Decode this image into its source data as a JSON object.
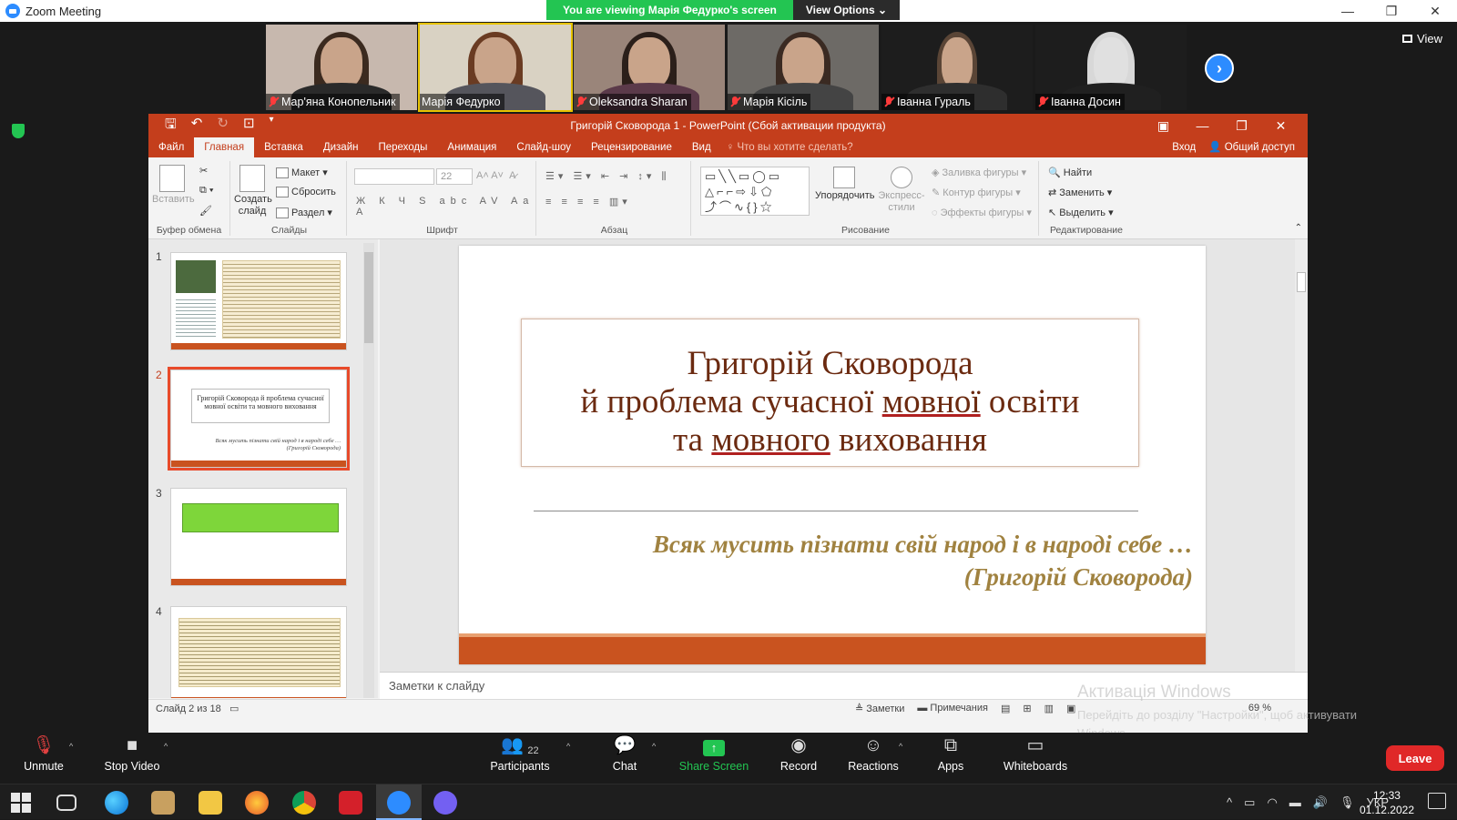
{
  "zoom": {
    "window_title": "Zoom Meeting",
    "share_banner": "You are viewing Марія Федурко's screen",
    "view_options": "View Options",
    "view_label": "View",
    "participants": [
      {
        "name": "Мар'яна Конопельник",
        "muted": true
      },
      {
        "name": "Марія Федурко",
        "muted": false
      },
      {
        "name": "Oleksandra Sharan",
        "muted": true
      },
      {
        "name": "Марія Кісіль",
        "muted": true
      },
      {
        "name": "Іванна Гураль",
        "muted": true
      },
      {
        "name": "Іванна Досин",
        "muted": true
      }
    ],
    "toolbar": {
      "unmute": "Unmute",
      "stop_video": "Stop Video",
      "participants": "Participants",
      "participants_count": "22",
      "chat": "Chat",
      "share_screen": "Share Screen",
      "record": "Record",
      "reactions": "Reactions",
      "apps": "Apps",
      "whiteboards": "Whiteboards",
      "leave": "Leave"
    }
  },
  "ppt": {
    "title": "Григорій Сковорода 1 - PowerPoint (Сбой активации продукта)",
    "tabs": [
      "Файл",
      "Главная",
      "Вставка",
      "Дизайн",
      "Переходы",
      "Анимация",
      "Слайд-шоу",
      "Рецензирование",
      "Вид"
    ],
    "selected_tab": "Главная",
    "tell_me": "Что вы хотите сделать?",
    "sign_in": "Вход",
    "share": "Общий доступ",
    "ribbon": {
      "paste": "Вставить",
      "clipboard": "Буфер обмена",
      "new_slide": "Создать слайд",
      "layout": "Макет",
      "reset": "Сбросить",
      "section": "Раздел",
      "slides": "Слайды",
      "font_size": "22",
      "font": "Шрифт",
      "paragraph": "Абзац",
      "arrange": "Упорядочить",
      "quick_styles": "Экспресс-стили",
      "shape_fill": "Заливка фигуры",
      "shape_outline": "Контур фигуры",
      "shape_effects": "Эффекты фигуры",
      "drawing": "Рисование",
      "find": "Найти",
      "replace": "Заменить",
      "select": "Выделить",
      "editing": "Редактирование"
    },
    "thumbs": [
      {
        "num": "1"
      },
      {
        "num": "2",
        "title": "Григорій Сковорода й проблема сучасної мовної освіти та мовного виховання",
        "quote": "Всяк мусить пізнати свій народ і в народі себе … (Григорій Сковорода)"
      },
      {
        "num": "3"
      },
      {
        "num": "4"
      }
    ],
    "slide": {
      "title_line1": "Григорій Сковорода",
      "title_line2_a": "й проблема сучасної ",
      "title_line2_b": "мовної",
      "title_line2_c": " освіти",
      "title_line3_a": "та ",
      "title_line3_b": "мовного",
      "title_line3_c": " виховання",
      "quote_line1": "Всяк мусить пізнати свій народ і в народі себе …",
      "quote_line2": "(Григорій Сковорода)"
    },
    "notes_placeholder": "Заметки к слайду",
    "status": {
      "slide_of": "Слайд 2 из 18",
      "notes": "Заметки",
      "comments": "Примечания",
      "zoom": "69 %"
    }
  },
  "activation": {
    "line1": "Активація Windows",
    "line2": "Перейдіть до розділу \"Настройки\", щоб активувати Windows."
  },
  "taskbar": {
    "lang": "УКР",
    "time": "12:33",
    "date": "01.12.2022"
  }
}
